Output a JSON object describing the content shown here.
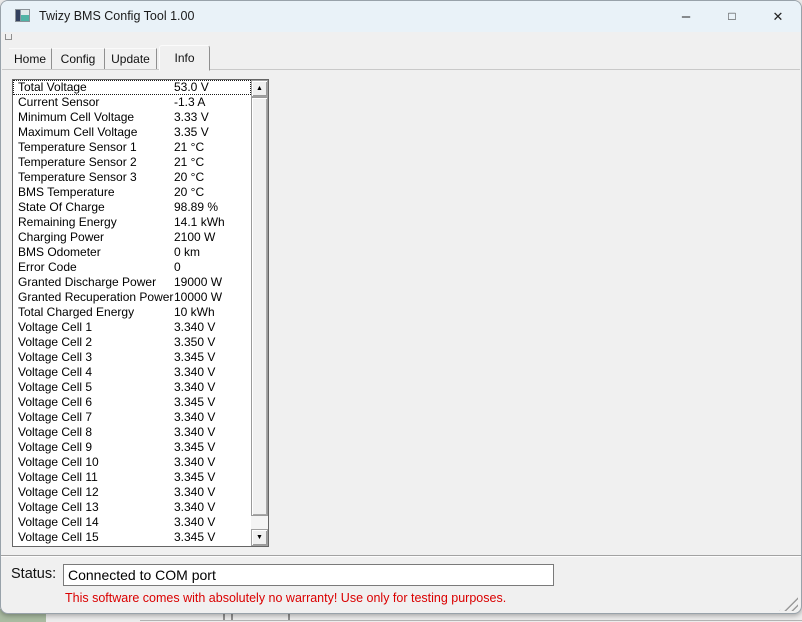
{
  "colors": {
    "titlebar_bg": "#e9f2f8",
    "body_bg": "#f0f0f0",
    "accent_border": "#98a2aa",
    "warning_red": "#da0000"
  },
  "window": {
    "title": "Twizy BMS Config Tool 1.00"
  },
  "icons": {
    "app_icon": "application-image-icon",
    "minimize": "–",
    "maximize": "□",
    "close": "✕",
    "scroll_up": "▲",
    "scroll_down": "▼",
    "resize_grip": "diagonal-grip"
  },
  "tabs": {
    "selected": "Info",
    "items": [
      {
        "label": "Home"
      },
      {
        "label": "Config"
      },
      {
        "label": "Update"
      },
      {
        "label": "Info"
      }
    ]
  },
  "info_list": {
    "focused_index": 0,
    "items": [
      {
        "label": "Total Voltage",
        "value": "53.0 V"
      },
      {
        "label": "Current Sensor",
        "value": "-1.3 A"
      },
      {
        "label": "Minimum Cell Voltage",
        "value": "3.33 V"
      },
      {
        "label": "Maximum Cell Voltage",
        "value": "3.35 V"
      },
      {
        "label": "Temperature Sensor 1",
        "value": "21 °C"
      },
      {
        "label": "Temperature Sensor 2",
        "value": "21 °C"
      },
      {
        "label": "Temperature Sensor 3",
        "value": "20 °C"
      },
      {
        "label": "BMS Temperature",
        "value": "20 °C"
      },
      {
        "label": "State Of Charge",
        "value": "98.89 %"
      },
      {
        "label": "Remaining Energy",
        "value": "14.1 kWh"
      },
      {
        "label": "Charging Power",
        "value": "2100 W"
      },
      {
        "label": "BMS Odometer",
        "value": "0 km"
      },
      {
        "label": "Error Code",
        "value": "0"
      },
      {
        "label": "Granted Discharge Power",
        "value": "19000 W"
      },
      {
        "label": "Granted Recuperation Power",
        "value": "10000 W"
      },
      {
        "label": "Total Charged Energy",
        "value": "10 kWh"
      },
      {
        "label": "Voltage Cell 1",
        "value": "3.340 V"
      },
      {
        "label": "Voltage Cell 2",
        "value": "3.350 V"
      },
      {
        "label": "Voltage Cell 3",
        "value": "3.345 V"
      },
      {
        "label": "Voltage Cell 4",
        "value": "3.340 V"
      },
      {
        "label": "Voltage Cell 5",
        "value": "3.340 V"
      },
      {
        "label": "Voltage Cell 6",
        "value": "3.345 V"
      },
      {
        "label": "Voltage Cell 7",
        "value": "3.340 V"
      },
      {
        "label": "Voltage Cell 8",
        "value": "3.340 V"
      },
      {
        "label": "Voltage Cell 9",
        "value": "3.345 V"
      },
      {
        "label": "Voltage Cell 10",
        "value": "3.340 V"
      },
      {
        "label": "Voltage Cell 11",
        "value": "3.345 V"
      },
      {
        "label": "Voltage Cell 12",
        "value": "3.340 V"
      },
      {
        "label": "Voltage Cell 13",
        "value": "3.340 V"
      },
      {
        "label": "Voltage Cell 14",
        "value": "3.340 V"
      },
      {
        "label": "Voltage Cell 15",
        "value": "3.345 V"
      }
    ]
  },
  "status": {
    "label": "Status:",
    "value": "Connected to COM port",
    "warning": "This software comes with absolutely no warranty! Use only for testing purposes."
  }
}
